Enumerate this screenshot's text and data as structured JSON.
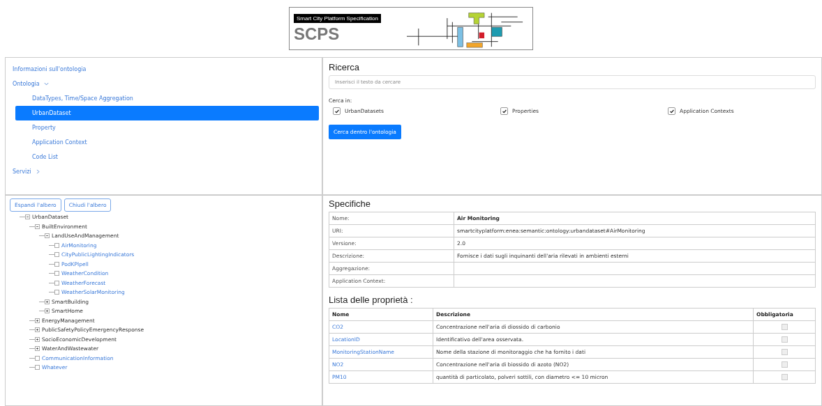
{
  "logo": {
    "tagline": "Smart City Platform Specification",
    "title": "SCPS"
  },
  "menu": [
    {
      "label": "Informazioni sull'ontologia",
      "selected": false
    },
    {
      "label": "Ontologia",
      "selected": false,
      "expanded": true,
      "children": [
        {
          "label": "DataTypes, Time/Space Aggregation",
          "selected": false
        },
        {
          "label": "UrbanDataset",
          "selected": true
        },
        {
          "label": "Property",
          "selected": false
        },
        {
          "label": "Application Context",
          "selected": false
        },
        {
          "label": "Code List",
          "selected": false
        }
      ]
    },
    {
      "label": "Servizi",
      "selected": false,
      "expanded": false
    }
  ],
  "tree_buttons": [
    "Espandi l'albero",
    "Chiudi l'albero"
  ],
  "tree": [
    {
      "label": "UrbanDataset",
      "kind": "folder",
      "expanded": true,
      "children": [
        {
          "label": "BuiltEnvironment",
          "kind": "folder",
          "expanded": true,
          "children": [
            {
              "label": "LandUseAndManagement",
              "kind": "folder",
              "expanded": true,
              "children": [
                {
                  "label": "AirMonitoring",
                  "kind": "leaf"
                },
                {
                  "label": "CityPublicLightingIndicators",
                  "kind": "leaf"
                },
                {
                  "label": "PodKPIpell",
                  "kind": "leaf"
                },
                {
                  "label": "WeatherCondition",
                  "kind": "leaf"
                },
                {
                  "label": "WeatherForecast",
                  "kind": "leaf"
                },
                {
                  "label": "WeatherSolarMonitoring",
                  "kind": "leaf"
                }
              ]
            },
            {
              "label": "SmartBuilding",
              "kind": "folder",
              "expanded": false
            },
            {
              "label": "SmartHome",
              "kind": "folder",
              "expanded": false
            }
          ]
        },
        {
          "label": "EnergyManagement",
          "kind": "folder",
          "expanded": false
        },
        {
          "label": "PublicSafetyPolicyEmergencyResponse",
          "kind": "folder",
          "expanded": false
        },
        {
          "label": "SocioEconomicDevelopment",
          "kind": "folder",
          "expanded": false
        },
        {
          "label": "WaterAndWastewater",
          "kind": "folder",
          "expanded": false
        },
        {
          "label": "CommunicationInformation",
          "kind": "leaf"
        },
        {
          "label": "Whatever",
          "kind": "leaf"
        }
      ]
    }
  ],
  "search": {
    "title": "Ricerca",
    "placeholder": "Inserisci il testo da cercare",
    "scope_label": "Cerca in:",
    "options": [
      {
        "label": "UrbanDatasets",
        "checked": true
      },
      {
        "label": "Properties",
        "checked": true
      },
      {
        "label": "Application Contexts",
        "checked": true
      }
    ],
    "button": "Cerca dentro l'ontologia"
  },
  "spec": {
    "title": "Specifiche",
    "rows": [
      {
        "label": "Nome:",
        "value": "Air Monitoring",
        "bold": true
      },
      {
        "label": "URI:",
        "value": "smartcityplatform:enea:semantic:ontology:urbandataset#AirMonitoring",
        "bold": false
      },
      {
        "label": "Versione:",
        "value": "2.0",
        "bold": false
      },
      {
        "label": "Descrizione:",
        "value": "Fornisce i dati sugli inquinanti dell'aria rilevati in ambienti esterni",
        "bold": false
      },
      {
        "label": "Aggregazione:"
      },
      {
        "label": "Application Context:"
      }
    ]
  },
  "properties": {
    "title": "Lista delle proprietà :",
    "columns": [
      "Nome",
      "Descrizione",
      "Obbligatoria"
    ],
    "rows": [
      {
        "name": "CO2",
        "description": "Concentrazione nell'aria di diossido di carbonio",
        "checked": false
      },
      {
        "name": "LocationID",
        "description": "Identificativo dell'area osservata.",
        "checked": false
      },
      {
        "name": "MonitoringStationName",
        "description": "Nome della stazione di monitoraggio che ha fornito i dati",
        "checked": false
      },
      {
        "name": "NO2",
        "description": "Concentrazione nell'aria di biossido di azoto (NO2)",
        "checked": false
      },
      {
        "name": "PM10",
        "description": "quantità di particolato, polveri sottili, con diametro <= 10 micron",
        "checked": false
      }
    ]
  }
}
